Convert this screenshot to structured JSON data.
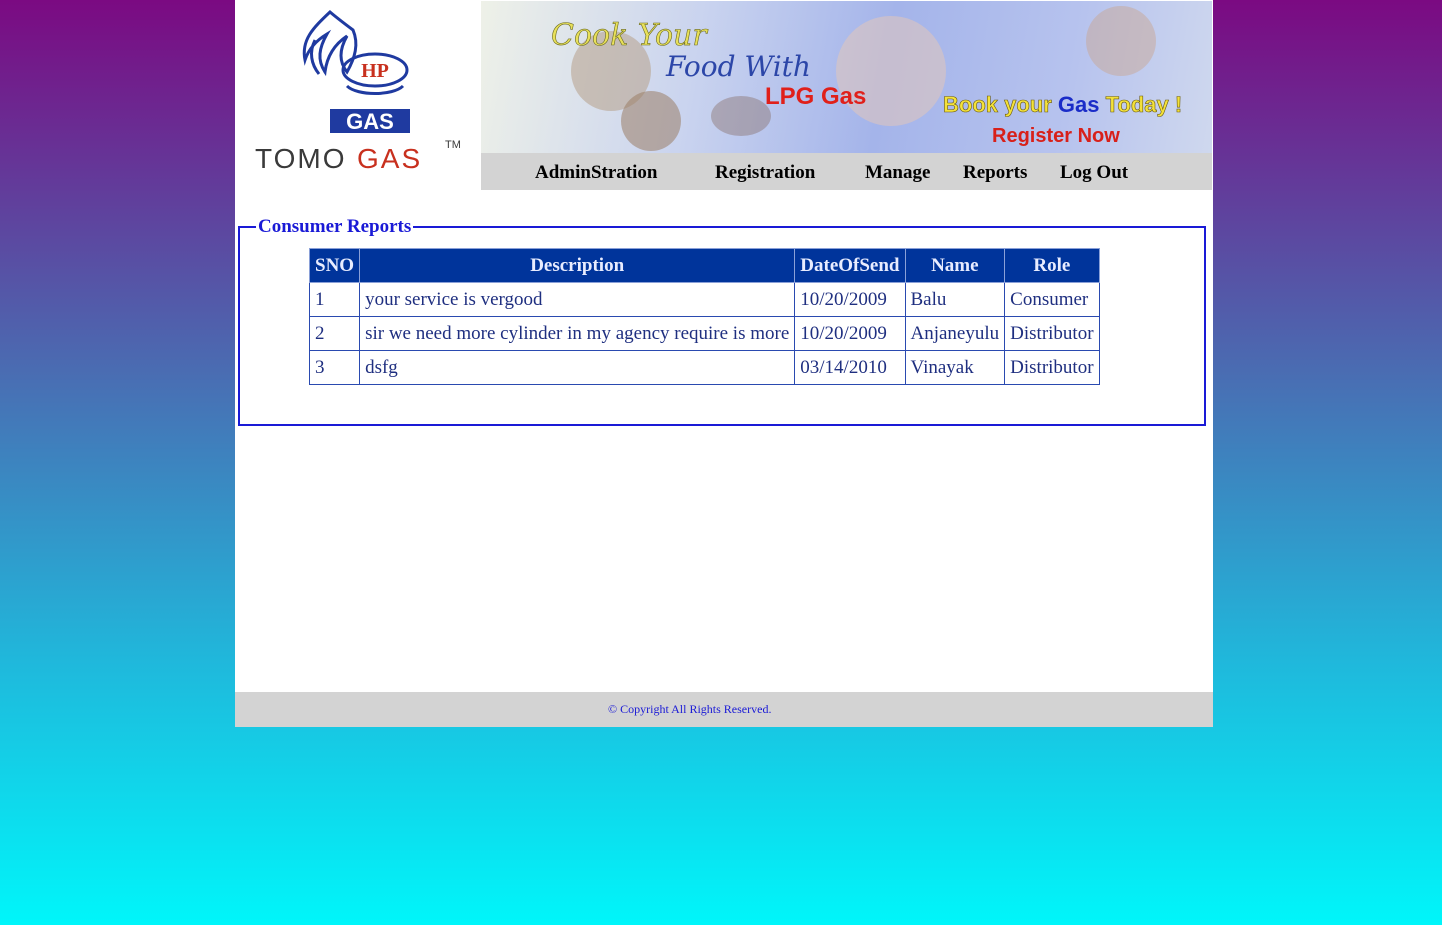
{
  "logo": {
    "brand_top": "HP",
    "brand_bottom": "GAS",
    "wordmark_left": "TOMO",
    "wordmark_right": "GAS",
    "trademark": "TM"
  },
  "banner": {
    "line1": "Cook Your",
    "line2": "Food With",
    "line3": "LPG Gas",
    "book_prefix": "Book your ",
    "book_gas": "Gas",
    "book_suffix": " Today !",
    "register": "Register Now"
  },
  "nav": {
    "items": [
      {
        "label": "AdminStration"
      },
      {
        "label": "Registration"
      },
      {
        "label": "Manage"
      },
      {
        "label": "Reports"
      },
      {
        "label": "Log Out"
      }
    ]
  },
  "reports": {
    "legend": "Consumer Reports",
    "columns": [
      "SNO",
      "Description",
      "DateOfSend",
      "Name",
      "Role"
    ],
    "rows": [
      {
        "sno": "1",
        "description": "your service is vergood",
        "date": "10/20/2009",
        "name": "Balu",
        "role": "Consumer"
      },
      {
        "sno": "2",
        "description": "sir we need more cylinder in my agency require is more",
        "date": "10/20/2009",
        "name": "Anjaneyulu",
        "role": "Distributor"
      },
      {
        "sno": "3",
        "description": "dsfg",
        "date": "03/14/2010",
        "name": "Vinayak",
        "role": "Distributor"
      }
    ]
  },
  "footer": {
    "copyright": "© Copyright All Rights Reserved."
  },
  "colors": {
    "legend": "#1a1ad6",
    "header_bg": "#00349b",
    "nav_bg": "#d3d3d3"
  }
}
